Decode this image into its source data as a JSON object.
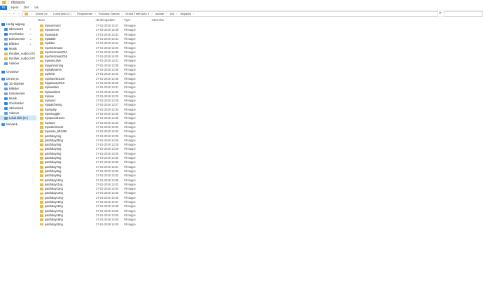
{
  "window": {
    "title": "dlcpacks"
  },
  "ribbon": {
    "tabs": [
      "Fil",
      "Hjem",
      "Del",
      "Vis"
    ]
  },
  "address": {
    "crumbs": [
      "Denne pc",
      "Lokal disk (C:)",
      "Programmer",
      "Rockstar Games",
      "Grand Theft Auto V",
      "update",
      "x64",
      "dlcpacks"
    ]
  },
  "colors": {
    "accent": "#1979ca",
    "folder": "#e7b94a",
    "selection": "#cce8ff"
  },
  "nav": {
    "items": [
      {
        "label": "Hurtig adgang",
        "icon": "star-icon",
        "pinned": false
      },
      {
        "label": "Skrivebord",
        "icon": "desktop-icon",
        "pinned": true
      },
      {
        "label": "Overførsler",
        "icon": "download-icon",
        "pinned": true
      },
      {
        "label": "Dokumenter",
        "icon": "document-icon",
        "pinned": true
      },
      {
        "label": "Billeder",
        "icon": "picture-icon",
        "pinned": true
      },
      {
        "label": "Musik",
        "icon": "music-icon",
        "pinned": false
      },
      {
        "label": "Rooftek_Audio1470",
        "icon": "folder-icon",
        "pinned": false
      },
      {
        "label": "Rooftek_Audio1470",
        "icon": "folder-icon",
        "pinned": false
      },
      {
        "label": "Videoer",
        "icon": "video-icon",
        "pinned": false
      },
      {
        "label": "OneDrive",
        "icon": "cloud-icon",
        "pinned": false
      },
      {
        "label": "Denne pc",
        "icon": "computer-icon",
        "pinned": false
      },
      {
        "label": "3D-objekter",
        "icon": "cube-icon",
        "pinned": false
      },
      {
        "label": "Billeder",
        "icon": "picture-icon",
        "pinned": false
      },
      {
        "label": "Dokumenter",
        "icon": "document-icon",
        "pinned": false
      },
      {
        "label": "Musik",
        "icon": "music-icon",
        "pinned": false
      },
      {
        "label": "Overførsler",
        "icon": "download-icon",
        "pinned": false
      },
      {
        "label": "Skrivebord",
        "icon": "desktop-icon",
        "pinned": false
      },
      {
        "label": "Videoer",
        "icon": "video-icon",
        "pinned": false
      },
      {
        "label": "Lokal disk (C:)",
        "icon": "drive-icon",
        "pinned": false,
        "selected": true
      },
      {
        "label": "Netværk",
        "icon": "network-icon",
        "pinned": false
      }
    ]
  },
  "columns": {
    "name": "Navn",
    "date": "Ændringsdato",
    "type": "Type",
    "size": "Størrelse"
  },
  "files": [
    {
      "name": "mpsummer2",
      "date": "27-01-2019 13:47",
      "type": "Filmappe"
    },
    {
      "name": "mpsummer",
      "date": "27-01-2019 13:45",
      "type": "Filmappe"
    },
    {
      "name": "mpassault",
      "date": "27-01-2019 13:31",
      "type": "Filmappe"
    },
    {
      "name": "mpbattle",
      "date": "27-01-2019 13:44",
      "type": "Filmappe"
    },
    {
      "name": "mpbiker",
      "date": "27-01-2019 13:44",
      "type": "Filmappe"
    },
    {
      "name": "mpchristmas2",
      "date": "27-01-2019 13:29",
      "type": "Filmappe"
    },
    {
      "name": "mpchristmas2017",
      "date": "27-01-2019 13:38",
      "type": "Filmappe"
    },
    {
      "name": "mpchristmas2018",
      "date": "27-01-2019 14:00",
      "type": "Filmappe"
    },
    {
      "name": "mpexecutive",
      "date": "27-01-2019 13:41",
      "type": "Filmappe"
    },
    {
      "name": "mpgunrunning",
      "date": "27-01-2019 13:38",
      "type": "Filmappe"
    },
    {
      "name": "mphalloween",
      "date": "27-01-2019 13:30",
      "type": "Filmappe"
    },
    {
      "name": "mpheist",
      "date": "27-01-2019 13:25",
      "type": "Filmappe"
    },
    {
      "name": "mpimportexport",
      "date": "27-01-2019 13:45",
      "type": "Filmappe"
    },
    {
      "name": "mpjanuary2016",
      "date": "27-01-2019 13:28",
      "type": "Filmappe"
    },
    {
      "name": "mplowrider",
      "date": "27-01-2019 13:31",
      "type": "Filmappe"
    },
    {
      "name": "mplowrider2",
      "date": "27-01-2019 13:32",
      "type": "Filmappe"
    },
    {
      "name": "mpluxe",
      "date": "27-01-2019 13:29",
      "type": "Filmappe"
    },
    {
      "name": "mpluxe2",
      "date": "27-01-2019 13:29",
      "type": "Filmappe"
    },
    {
      "name": "mppatchesng",
      "date": "27-01-2019 13:27",
      "type": "Filmappe"
    },
    {
      "name": "mpreplay",
      "date": "27-01-2019 13:30",
      "type": "Filmappe"
    },
    {
      "name": "mpsmuggler",
      "date": "27-01-2019 13:46",
      "type": "Filmappe"
    },
    {
      "name": "mpspecialraces",
      "date": "27-01-2019 13:45",
      "type": "Filmappe"
    },
    {
      "name": "mpstunt",
      "date": "27-01-2019 13:42",
      "type": "Filmappe"
    },
    {
      "name": "mpvalentines2",
      "date": "27-01-2019 13:32",
      "type": "Filmappe"
    },
    {
      "name": "mpxmas_604490",
      "date": "27-01-2019 13:32",
      "type": "Filmappe"
    },
    {
      "name": "patchday1ng",
      "date": "27-01-2019 13:25",
      "type": "Filmappe"
    },
    {
      "name": "patchday2bng",
      "date": "27-01-2019 13:26",
      "type": "Filmappe"
    },
    {
      "name": "patchday2ng",
      "date": "27-01-2019 13:26",
      "type": "Filmappe"
    },
    {
      "name": "patchday3ng",
      "date": "27-01-2019 13:29",
      "type": "Filmappe"
    },
    {
      "name": "patchday4ng",
      "date": "27-01-2019 13:29",
      "type": "Filmappe"
    },
    {
      "name": "patchday5ng",
      "date": "27-01-2019 13:30",
      "type": "Filmappe"
    },
    {
      "name": "patchday6ng",
      "date": "27-01-2019 13:30",
      "type": "Filmappe"
    },
    {
      "name": "patchday7ng",
      "date": "27-01-2019 13:31",
      "type": "Filmappe"
    },
    {
      "name": "patchday8ng",
      "date": "27-01-2019 13:32",
      "type": "Filmappe"
    },
    {
      "name": "patchday9ng",
      "date": "27-01-2019 13:32",
      "type": "Filmappe"
    },
    {
      "name": "patchday10ng",
      "date": "27-01-2019 13:35",
      "type": "Filmappe"
    },
    {
      "name": "patchday11ng",
      "date": "27-01-2019 13:42",
      "type": "Filmappe"
    },
    {
      "name": "patchday12ng",
      "date": "27-01-2019 13:44",
      "type": "Filmappe"
    },
    {
      "name": "patchday13ng",
      "date": "27-01-2019 13:45",
      "type": "Filmappe"
    },
    {
      "name": "patchday14ng",
      "date": "27-01-2019 13:46",
      "type": "Filmappe"
    },
    {
      "name": "patchday15ng",
      "date": "27-01-2019 13:47",
      "type": "Filmappe"
    },
    {
      "name": "patchday16ng",
      "date": "27-01-2019 13:48",
      "type": "Filmappe"
    },
    {
      "name": "patchday17ng",
      "date": "27-01-2019 13:50",
      "type": "Filmappe"
    },
    {
      "name": "patchday18ng",
      "date": "27-01-2019 13:55",
      "type": "Filmappe"
    },
    {
      "name": "patchday19ng",
      "date": "27-01-2019 13:58",
      "type": "Filmappe"
    },
    {
      "name": "patchday20ng",
      "date": "27-01-2019 14:00",
      "type": "Filmappe"
    }
  ]
}
